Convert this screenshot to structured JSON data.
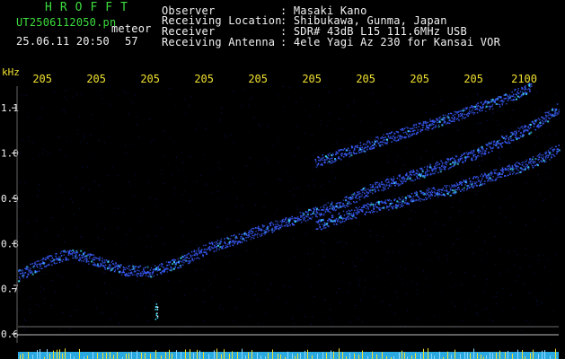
{
  "header": {
    "logo": "HROFFT",
    "filename": "UT2506112050.pn",
    "meteor_label": "meteor",
    "datetime": "25.06.11 20:50",
    "count": "57",
    "info_rows": [
      {
        "key": "Observer",
        "value": ": Masaki Kano"
      },
      {
        "key": "Receiving Location",
        "value": ": Shibukawa, Gunma, Japan"
      },
      {
        "key": "Receiver",
        "value": ": SDR# 43dB L15 111.6MHz USB"
      },
      {
        "key": "Receiving Antenna",
        "value": ": 4ele Yagi Az 230 for Kansai VOR"
      }
    ]
  },
  "colors": {
    "background": "#000000",
    "header_green": "#3ddc3d",
    "header_white": "#f2f2f2",
    "axis_yellow": "#f0e030",
    "trace_blue": "#3a5cff",
    "trace_cyan": "#40e0ff",
    "noise_floor": "#2aa8e0"
  },
  "chart_data": {
    "type": "scatter",
    "y_unit": "kHz",
    "x_tick_labels": [
      "205",
      "205",
      "205",
      "205",
      "205",
      "205",
      "205",
      "205",
      "205",
      "2100"
    ],
    "y_tick_labels": [
      "1.1",
      "1.0",
      "0.9",
      "0.8",
      "0.7",
      "0.6"
    ],
    "ylim": [
      0.6,
      1.15
    ],
    "grid": false,
    "series": [
      {
        "points": [
          [
            0,
            0.73
          ],
          [
            0.05,
            0.76
          ],
          [
            0.1,
            0.78
          ],
          [
            0.15,
            0.76
          ],
          [
            0.2,
            0.74
          ],
          [
            0.25,
            0.74
          ],
          [
            0.3,
            0.76
          ],
          [
            0.35,
            0.79
          ],
          [
            0.4,
            0.81
          ],
          [
            0.45,
            0.83
          ],
          [
            0.5,
            0.85
          ],
          [
            0.55,
            0.87
          ],
          [
            0.6,
            0.89
          ],
          [
            0.65,
            0.92
          ],
          [
            0.7,
            0.94
          ],
          [
            0.75,
            0.96
          ],
          [
            0.8,
            0.98
          ],
          [
            0.85,
            1.0
          ],
          [
            0.9,
            1.03
          ],
          [
            0.95,
            1.06
          ],
          [
            1.0,
            1.1
          ]
        ]
      },
      {
        "points": [
          [
            0.55,
            0.98
          ],
          [
            0.6,
            1.0
          ],
          [
            0.65,
            1.02
          ],
          [
            0.7,
            1.04
          ],
          [
            0.75,
            1.06
          ],
          [
            0.8,
            1.08
          ],
          [
            0.85,
            1.1
          ],
          [
            0.9,
            1.12
          ],
          [
            0.95,
            1.15
          ]
        ]
      },
      {
        "points": [
          [
            0.55,
            0.84
          ],
          [
            0.6,
            0.86
          ],
          [
            0.65,
            0.88
          ],
          [
            0.7,
            0.89
          ],
          [
            0.75,
            0.91
          ],
          [
            0.8,
            0.92
          ],
          [
            0.85,
            0.94
          ],
          [
            0.9,
            0.96
          ],
          [
            0.95,
            0.98
          ],
          [
            1.0,
            1.01
          ]
        ]
      }
    ],
    "noise_floor_level": 0.6
  }
}
